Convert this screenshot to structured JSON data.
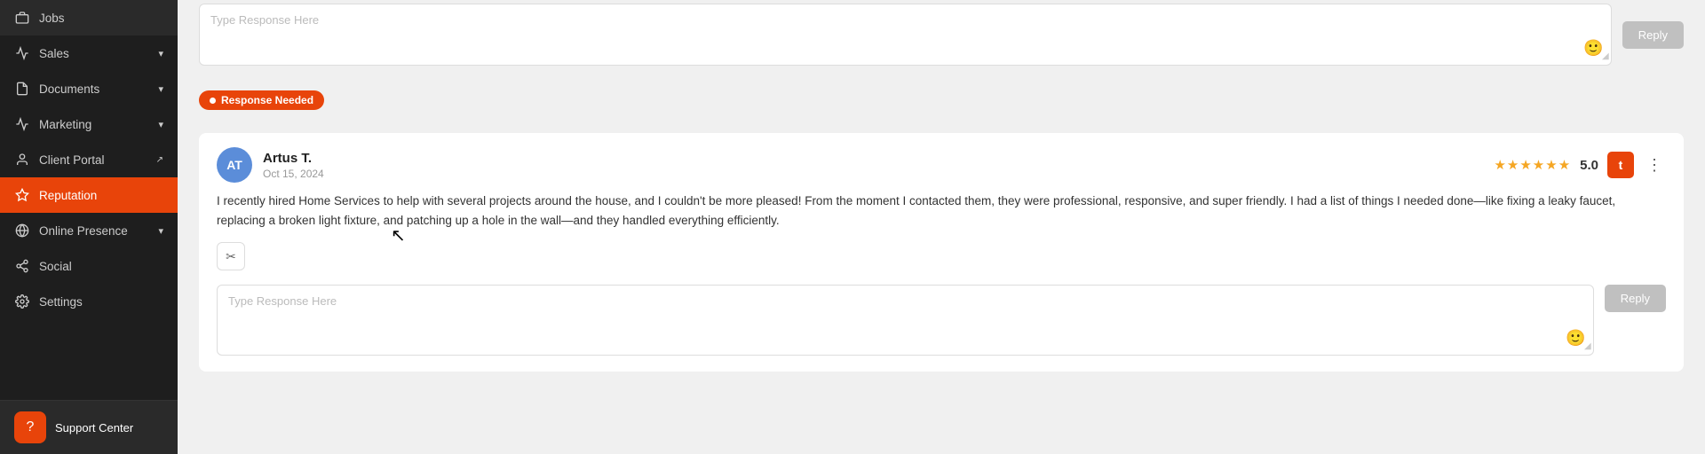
{
  "sidebar": {
    "items": [
      {
        "id": "jobs",
        "label": "Jobs",
        "icon": "briefcase",
        "hasChevron": false
      },
      {
        "id": "sales",
        "label": "Sales",
        "icon": "chart-bar",
        "hasChevron": true
      },
      {
        "id": "documents",
        "label": "Documents",
        "icon": "file",
        "hasChevron": true
      },
      {
        "id": "marketing",
        "label": "Marketing",
        "icon": "megaphone",
        "hasChevron": true
      },
      {
        "id": "client-portal",
        "label": "Client Portal",
        "icon": "person",
        "hasExtIcon": true
      },
      {
        "id": "reputation",
        "label": "Reputation",
        "icon": "star",
        "hasChevron": false,
        "active": true
      },
      {
        "id": "online-presence",
        "label": "Online Presence",
        "icon": "globe",
        "hasChevron": true
      },
      {
        "id": "social",
        "label": "Social",
        "icon": "share",
        "hasChevron": false
      },
      {
        "id": "settings",
        "label": "Settings",
        "icon": "gear",
        "hasChevron": false
      }
    ],
    "support": {
      "label": "Support Center",
      "icon": "?"
    }
  },
  "top_reply": {
    "placeholder": "Type Response Here",
    "reply_label": "Reply"
  },
  "response_badge": "Response Needed",
  "review": {
    "avatar_initials": "AT",
    "reviewer_name": "Artus T.",
    "reviewer_date": "Oct 15, 2024",
    "stars": "★★★★★★",
    "rating": "5.0",
    "platform_letter": "t",
    "body": "I recently hired Home Services to help with several projects around the house, and I couldn't be more pleased! From the moment I contacted them, they were professional, responsive, and super friendly. I had a list of things I needed done—like fixing a leaky faucet, replacing a broken light fixture, and patching up a hole in the wall—and they handled everything efficiently.",
    "tool_icon": "✂",
    "reply_placeholder": "Type Response Here",
    "reply_label": "Reply"
  }
}
